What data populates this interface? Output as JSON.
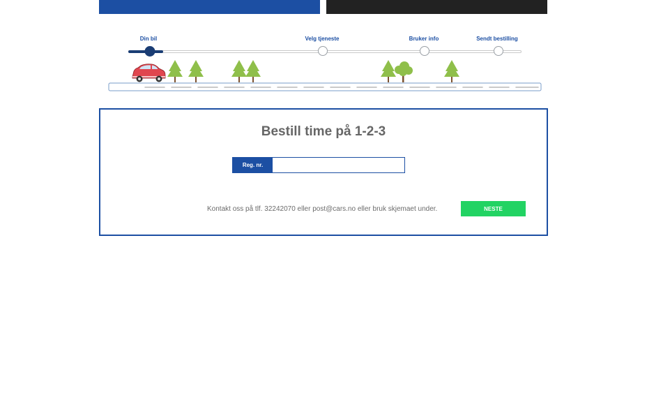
{
  "progress": {
    "steps": [
      {
        "label": "Din bil"
      },
      {
        "label": "Velg tjeneste"
      },
      {
        "label": "Bruker info"
      },
      {
        "label": "Sendt bestilling"
      }
    ],
    "current_step": 1
  },
  "form": {
    "title": "Bestill time på 1-2-3",
    "reg_label": "Reg. nr.",
    "reg_value": "",
    "contact_text": "Kontakt oss på tlf. 32242070 eller post@cars.no eller bruk skjemaet under.",
    "next_label": "NESTE"
  },
  "colors": {
    "primary": "#1c4fa3",
    "dark": "#222222",
    "accent_green": "#22d363",
    "tree_green": "#8fbf4a",
    "car_red": "#e0464f"
  }
}
